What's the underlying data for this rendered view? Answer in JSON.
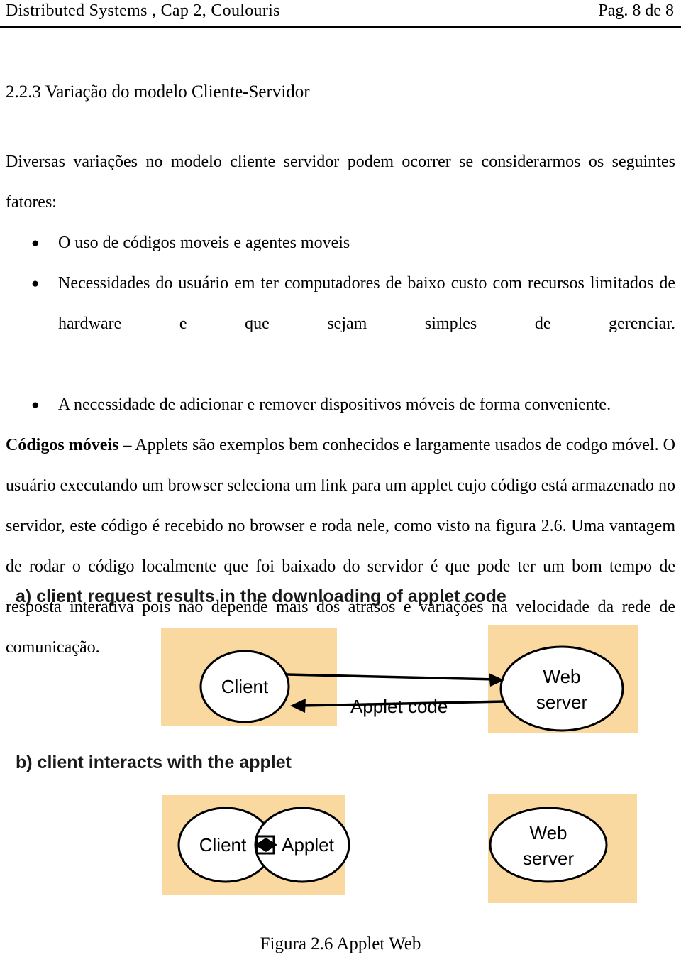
{
  "header": {
    "left_text": "Distributed Systems ,  Cap 2,  Coulouris",
    "right_text": "Pag. 8 de 8"
  },
  "section": {
    "heading": "2.2.3 Variação do modelo Cliente-Servidor"
  },
  "body": {
    "intro_paragraph": "Diversas variações no modelo cliente servidor podem ocorrer se considerarmos os seguintes fatores:",
    "bullets": [
      "O uso de códigos moveis e agentes moveis",
      "Necessidades do usuário em ter computadores de baixo custo com recursos limitados de hardware e que sejam simples de gerenciar.",
      "A necessidade de adicionar e remover dispositivos móveis de forma conveniente."
    ],
    "mobile_code_lead": "Códigos móveis",
    "mobile_code_rest": " – Applets são exemplos bem conhecidos e largamente usados de codgo móvel. O usuário executando um browser seleciona um link para um applet cujo código está armazenado no servidor, este código é  recebido no browser e roda nele, como visto na figura 2.6. Uma vantagem de rodar o código localmente que foi baixado do servidor é que pode ter um bom tempo de resposta interativa pois não depende mais dos atrasos e variações na velocidade da rede de comunicação."
  },
  "figure": {
    "panel_a_caption": "a) client request results in the downloading of applet code",
    "panel_b_caption": "b) client  interacts with the applet",
    "panel_a": {
      "client_label": "Client",
      "server_label_line1": "Web",
      "server_label_line2": "server",
      "edge_label": "Applet code"
    },
    "panel_b": {
      "client_label": "Client",
      "applet_label": "Applet",
      "server_label_line1": "Web",
      "server_label_line2": "server"
    },
    "caption": "Figura 2.6  Applet Web",
    "box_color": "#f9d9a0",
    "node_fill": "#ffffff",
    "stroke_color": "#000000"
  }
}
